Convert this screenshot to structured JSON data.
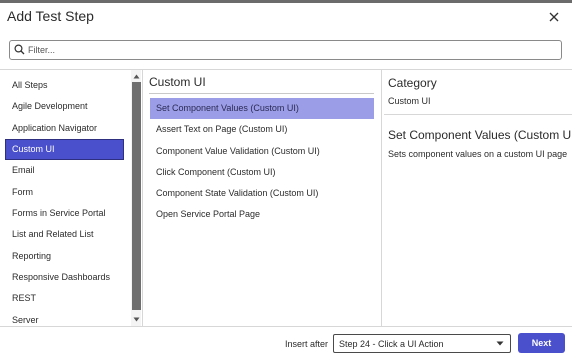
{
  "dialog": {
    "title": "Add Test Step",
    "close_icon": "close-icon"
  },
  "filter": {
    "placeholder": "Filter...",
    "value": "",
    "icon": "search-icon"
  },
  "categories": {
    "items": [
      {
        "label": "All Steps",
        "active": false
      },
      {
        "label": "Agile Development",
        "active": false
      },
      {
        "label": "Application Navigator",
        "active": false
      },
      {
        "label": "Custom UI",
        "active": true
      },
      {
        "label": "Email",
        "active": false
      },
      {
        "label": "Form",
        "active": false
      },
      {
        "label": "Forms in Service Portal",
        "active": false
      },
      {
        "label": "List and Related List",
        "active": false
      },
      {
        "label": "Reporting",
        "active": false
      },
      {
        "label": "Responsive Dashboards",
        "active": false
      },
      {
        "label": "REST",
        "active": false
      },
      {
        "label": "Server",
        "active": false
      }
    ]
  },
  "steps": {
    "title": "Custom UI",
    "items": [
      {
        "label": "Set Component Values (Custom UI)",
        "active": true
      },
      {
        "label": "Assert Text on Page (Custom UI)",
        "active": false
      },
      {
        "label": "Component Value Validation (Custom UI)",
        "active": false
      },
      {
        "label": "Click Component (Custom UI)",
        "active": false
      },
      {
        "label": "Component State Validation (Custom UI)",
        "active": false
      },
      {
        "label": "Open Service Portal Page",
        "active": false
      }
    ]
  },
  "details": {
    "category_label": "Category",
    "category_value": "Custom UI",
    "step_name": "Set Component Values (Custom UI)",
    "step_description": "Sets component values on a custom UI page"
  },
  "footer": {
    "insert_after_label": "Insert after",
    "insert_after_value": "Step 24 - Click a UI Action",
    "next_label": "Next"
  },
  "colors": {
    "accent": "#4a4fcc",
    "selected_step": "#9b9de6",
    "scroll_thumb": "#6f6f6f"
  }
}
